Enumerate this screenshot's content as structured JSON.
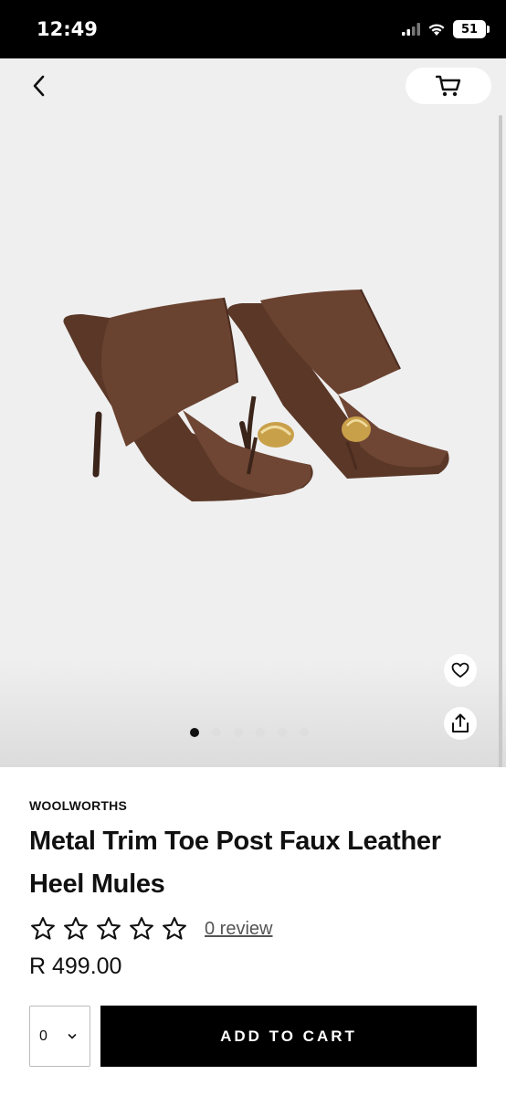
{
  "status_bar": {
    "time": "12:49",
    "battery": "51",
    "icons": [
      "signal-icon",
      "wifi-icon",
      "battery-icon"
    ]
  },
  "gallery": {
    "back_icon": "chevron-left-icon",
    "cart_icon": "cart-icon",
    "wishlist_icon": "heart-icon",
    "share_icon": "share-icon",
    "image_count": 6,
    "active_index": 0
  },
  "product": {
    "brand": "WOOLWORTHS",
    "title": "Metal Trim Toe Post Faux Leather Heel Mules",
    "rating_stars": 5,
    "rating_value": 0,
    "review_label": "0 review",
    "price": "R 499.00"
  },
  "purchase": {
    "quantity": "0",
    "add_to_cart_label": "ADD TO CART"
  },
  "colors": {
    "leather": "#5a3727",
    "gold": "#c9a04a",
    "button": "#000000",
    "gallery_bg": "#efefef"
  }
}
